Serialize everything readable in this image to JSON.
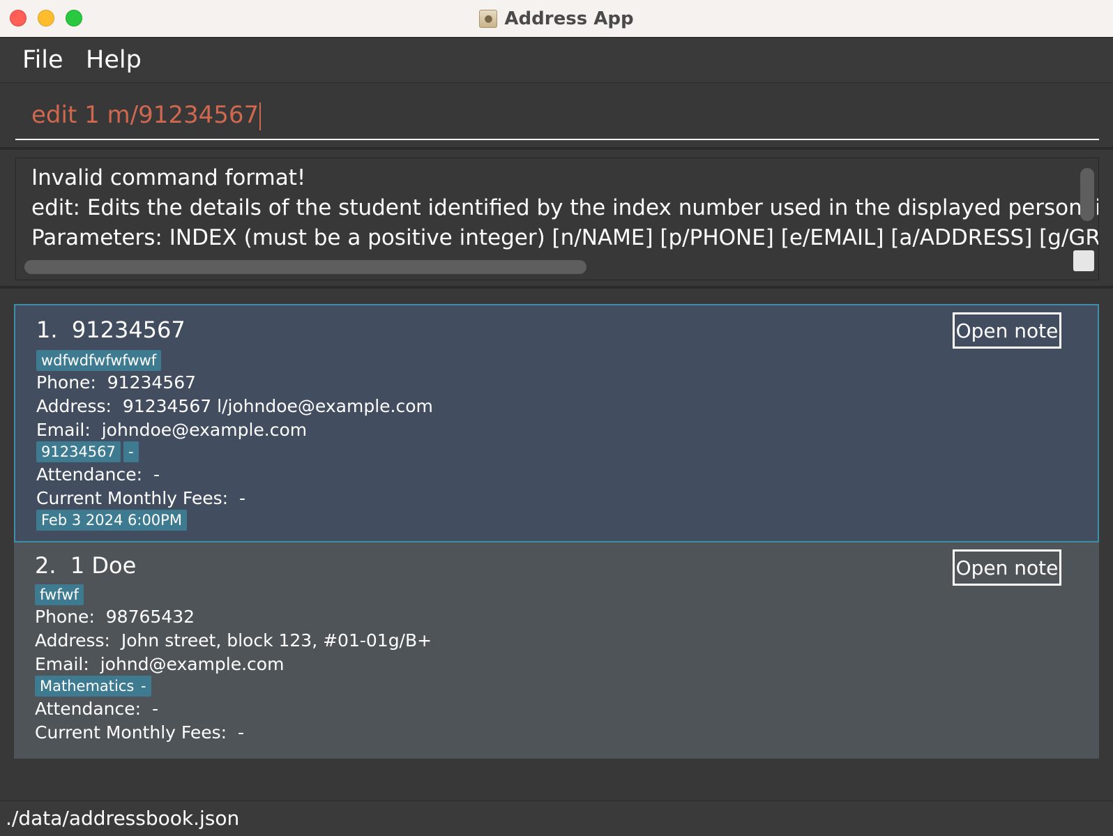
{
  "window": {
    "title": "Address App",
    "icon": "address-book-icon"
  },
  "menu": {
    "items": [
      "File",
      "Help"
    ]
  },
  "command": {
    "value": "edit 1 m/91234567"
  },
  "result": {
    "lines": [
      "Invalid command format!",
      "edit: Edits the details of the student identified by the index number used in the displayed person list. Exist",
      "Parameters: INDEX (must be a positive integer) [n/NAME] [p/PHONE] [e/EMAIL] [a/ADDRESS] [g/GRAD"
    ]
  },
  "persons": [
    {
      "index": "1.",
      "name": "91234567",
      "tag": "wdfwdfwfwfwwf",
      "phone_label": "Phone:",
      "phone": "91234567",
      "address_label": "Address:",
      "address": "91234567 l/johndoe@example.com",
      "email_label": "Email:",
      "email": "johndoe@example.com",
      "subject_tags": [
        "91234567",
        "-"
      ],
      "attendance_label": "Attendance:",
      "attendance": "-",
      "fees_label": "Current Monthly Fees:",
      "fees": "-",
      "lesson": "Feb 3 2024 6:00PM",
      "open_note_label": "Open note"
    },
    {
      "index": "2.",
      "name": "1 Doe",
      "tag": "fwfwf",
      "phone_label": "Phone:",
      "phone": "98765432",
      "address_label": "Address:",
      "address": "John street, block 123, #01-01g/B+",
      "email_label": "Email:",
      "email": "johnd@example.com",
      "subject_tags": [
        "Mathematics",
        "-"
      ],
      "attendance_label": "Attendance:",
      "attendance": "-",
      "fees_label": "Current Monthly Fees:",
      "fees": "-",
      "open_note_label": "Open note"
    }
  ],
  "status": {
    "path": "./data/addressbook.json"
  },
  "colors": {
    "command_text": "#d0684f",
    "tag_bg": "#3e7b91",
    "selected_card": "#424d5f",
    "selected_border": "#3d8ea8",
    "card_bg": "#4f5458"
  }
}
